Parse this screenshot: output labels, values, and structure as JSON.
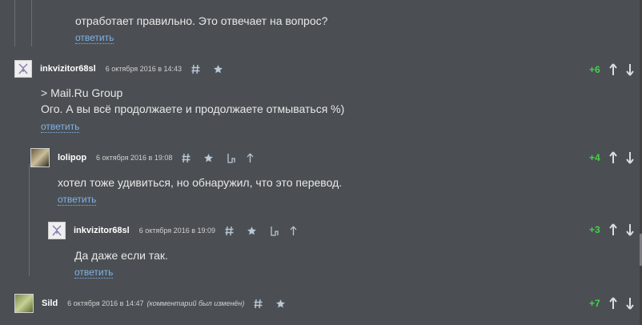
{
  "thread": {
    "top_fragment": {
      "text": "отработает правильно. Это отвечает на вопрос?",
      "reply_label": "ответить"
    },
    "comments": [
      {
        "username": "inkvizitor68sl",
        "date": "6 октября 2016 в 14:43",
        "score": "+6",
        "lines": [
          "> Mail.Ru Group",
          "Ого. А вы всё продолжаете и продолжаете отмываться %)"
        ],
        "reply_label": "ответить",
        "icons": [
          "hash-icon",
          "star-icon"
        ]
      },
      {
        "username": "lolipop",
        "date": "6 октября 2016 в 19:08",
        "score": "+4",
        "lines": [
          "хотел тоже удивиться, но обнаружил, что это перевод."
        ],
        "reply_label": "ответить",
        "icons": [
          "hash-icon",
          "star-icon",
          "parent-comment-icon",
          "arrow-up-icon"
        ]
      },
      {
        "username": "inkvizitor68sl",
        "date": "6 октября 2016 в 19:09",
        "score": "+3",
        "lines": [
          "Да даже если так."
        ],
        "reply_label": "ответить",
        "icons": [
          "hash-icon",
          "star-icon",
          "parent-comment-icon",
          "arrow-up-icon"
        ]
      },
      {
        "username": "Sild",
        "date": "6 октября 2016 в 14:47",
        "edited_note": "(комментарий был изменён)",
        "score": "+7",
        "icons": [
          "hash-icon",
          "star-icon"
        ]
      }
    ]
  },
  "colors": {
    "background": "#4b4f53",
    "score_positive": "#43d24a",
    "link": "#7fb3e8",
    "text": "#e8e8e8"
  }
}
